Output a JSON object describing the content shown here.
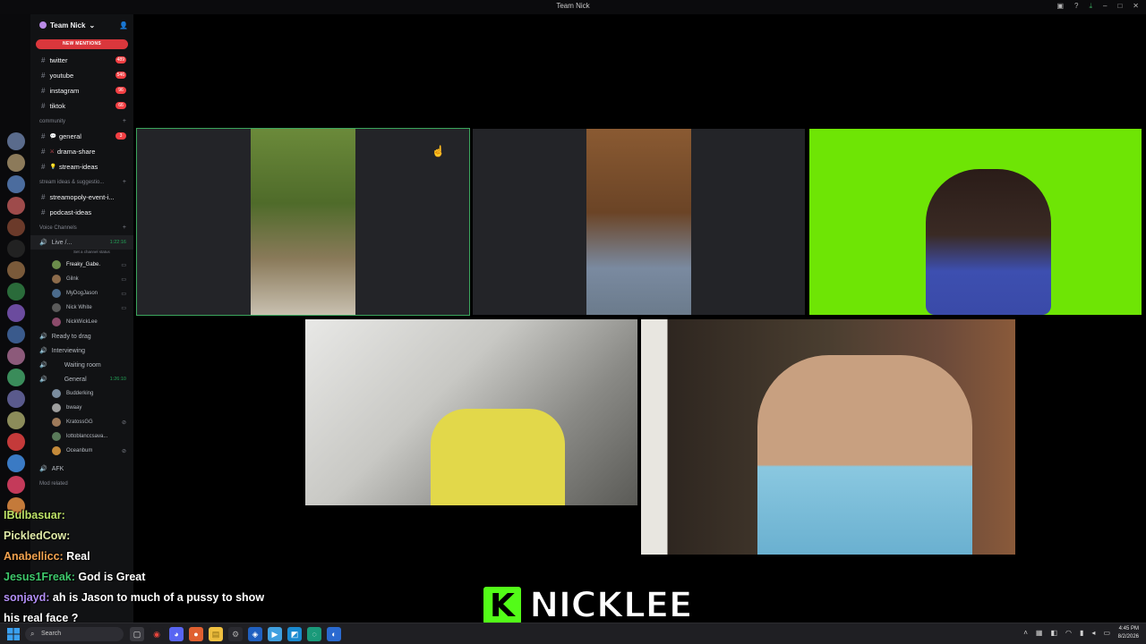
{
  "window": {
    "title": "Team Nick"
  },
  "titlebar_icons": [
    "inbox-icon",
    "help-icon",
    "download-icon",
    "minimize-icon",
    "maximize-icon",
    "close-icon"
  ],
  "server": {
    "name": "Team Nick",
    "new_mentions_label": "NEW MENTIONS"
  },
  "channels_top": [
    {
      "name": "twitter",
      "count": "489"
    },
    {
      "name": "youtube",
      "count": "546"
    },
    {
      "name": "instagram",
      "count": "96"
    },
    {
      "name": "tiktok",
      "count": "66"
    }
  ],
  "community": {
    "label": "community",
    "channels": [
      {
        "name": "general",
        "emoji": "💬",
        "count": "3"
      },
      {
        "name": "drama-share",
        "emoji": "⚔"
      },
      {
        "name": "stream-ideas",
        "emoji": "💡"
      }
    ]
  },
  "stream_ideas": {
    "label": "stream ideas & suggestio...",
    "channels": [
      {
        "name": "streamopoly-event-i..."
      },
      {
        "name": "podcast-ideas"
      }
    ]
  },
  "voice": {
    "label": "Voice Channels",
    "live": {
      "name": "Live /...",
      "timer": "1:22:16",
      "status": "Set a channel status"
    },
    "live_users": [
      "Freaky_Gabe.",
      "Gilnk",
      "MyDogJason",
      "Nick White",
      "NickWickLee"
    ],
    "others": [
      "Ready to drag",
      "Interviewing",
      "Waiting room"
    ],
    "general": {
      "name": "General",
      "timer": "1:26:10"
    },
    "general_users": [
      "Budderking",
      "bwaay",
      "KratossGG",
      "lottoblanccsava...",
      "Oceanbum"
    ],
    "afk": "AFK",
    "mod_label": "Mod related"
  },
  "chat": [
    {
      "user": "IBulbasuar:",
      "text": ""
    },
    {
      "user": "PickledCow:",
      "text": ""
    },
    {
      "user": "Anabellicc:",
      "text": "Real"
    },
    {
      "user": "Jesus1Freak:",
      "text": "God is Great"
    },
    {
      "user": "sonjayd:",
      "text": "ah is Jason to much of a pussy to show"
    },
    {
      "user": "",
      "text": "his real face ?"
    }
  ],
  "brand": {
    "logo_letter": "K",
    "name": "NICKLEE"
  },
  "taskbar": {
    "search_placeholder": "Search",
    "time": "4:45 PM",
    "date": "8/2/2026"
  },
  "colors": {
    "accent_green": "#3ba55d",
    "mention_red": "#da373c",
    "greenscreen": "#6ee505",
    "kick_green": "#53fc18"
  }
}
